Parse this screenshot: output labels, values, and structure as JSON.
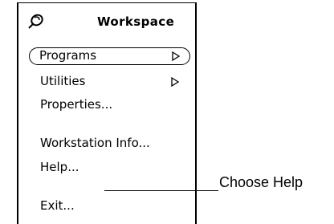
{
  "menu": {
    "title": "Workspace",
    "pin_icon": "pushpin-icon",
    "items": [
      {
        "label": "Programs",
        "submenu": true,
        "default": true
      },
      {
        "label": "Utilities",
        "submenu": true
      },
      {
        "label": "Properties..."
      },
      {
        "label": "Workstation Info..."
      },
      {
        "label": "Help..."
      },
      {
        "label": "Exit..."
      }
    ]
  },
  "callout": {
    "text": "Choose Help"
  }
}
